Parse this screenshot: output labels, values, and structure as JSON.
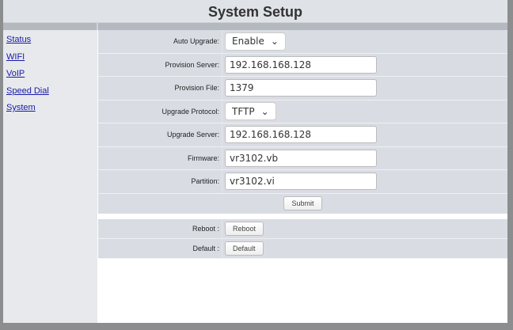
{
  "header": {
    "title": "System Setup"
  },
  "sidebar": {
    "items": [
      {
        "label": "Status"
      },
      {
        "label": "WIFI"
      },
      {
        "label": "VoIP"
      },
      {
        "label": "Speed Dial"
      },
      {
        "label": "System"
      }
    ]
  },
  "form": {
    "auto_upgrade": {
      "label": "Auto Upgrade:",
      "value": "Enable"
    },
    "provision_server": {
      "label": "Provision Server:",
      "value": "192.168.168.128"
    },
    "provision_file": {
      "label": "Provision File:",
      "value": "1379"
    },
    "upgrade_protocol": {
      "label": "Upgrade Protocol:",
      "value": "TFTP"
    },
    "upgrade_server": {
      "label": "Upgrade Server:",
      "value": "192.168.168.128"
    },
    "firmware": {
      "label": "Firmware:",
      "value": "vr3102.vb"
    },
    "partition": {
      "label": "Partition:",
      "value": "vr3102.vi"
    },
    "submit_label": "Submit"
  },
  "system": {
    "reboot": {
      "label": "Reboot :",
      "button": "Reboot"
    },
    "default": {
      "label": "Default :",
      "button": "Default"
    }
  }
}
